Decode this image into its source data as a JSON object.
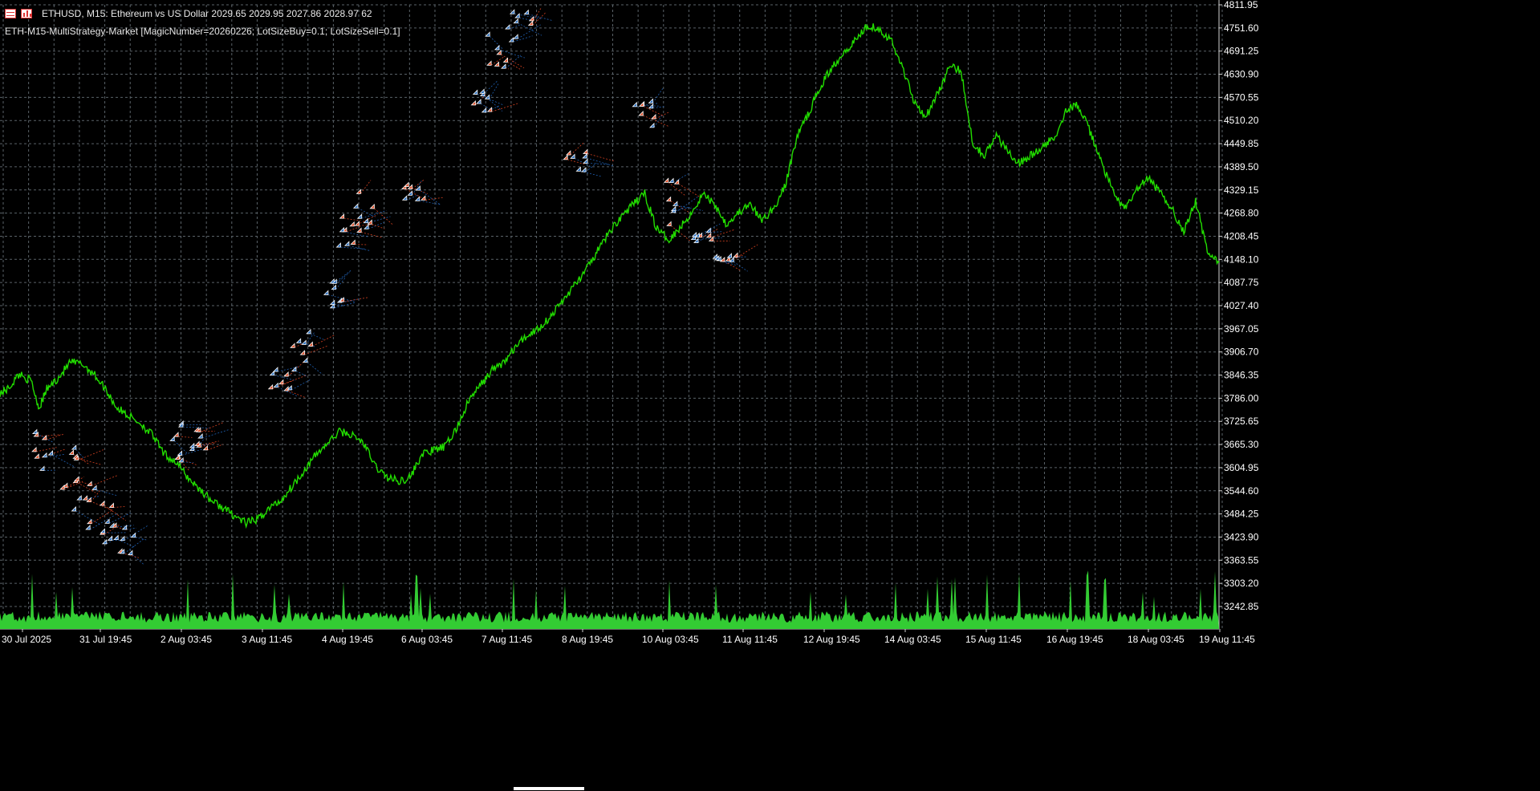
{
  "header": {
    "symbol_line": "ETHUSD, M15:  Ethereum vs US Dollar  2029.65 2029.95 2027.86 2028.97  62",
    "ea_line": "ETH-M15-MultiStrategy-Market [MagicNumber=20260226; LotSizeBuy=0.1; LotSizeSell=0.1]"
  },
  "icons": [
    "table-icon",
    "bar-chart-icon"
  ],
  "colors": {
    "background": "#000000",
    "grid": "#5a6268",
    "price_line": "#22dd00",
    "volume": "#33cc33",
    "buy_marker": "#2a6fc0",
    "sell_marker": "#e0502a",
    "buy_link": "#1f5fb0",
    "sell_link": "#d04020",
    "text": "#ffffff"
  },
  "chart_data": {
    "type": "line",
    "symbol": "ETHUSD",
    "timeframe": "M15",
    "y_ticks": [
      "4811.95",
      "4751.60",
      "4691.25",
      "4630.90",
      "4570.55",
      "4510.20",
      "4449.85",
      "4389.50",
      "4329.15",
      "4268.80",
      "4208.45",
      "4148.10",
      "4087.75",
      "4027.40",
      "3967.05",
      "3906.70",
      "3846.35",
      "3786.00",
      "3725.65",
      "3665.30",
      "3604.95",
      "3544.60",
      "3484.25",
      "3423.90",
      "3363.55",
      "3303.20",
      "3242.85"
    ],
    "ylim": [
      3242.85,
      4811.95
    ],
    "x_ticks": [
      "30 Jul 2025",
      "31 Jul 19:45",
      "2 Aug 03:45",
      "3 Aug 11:45",
      "4 Aug 19:45",
      "6 Aug 03:45",
      "7 Aug 11:45",
      "8 Aug 19:45",
      "10 Aug 03:45",
      "11 Aug 11:45",
      "12 Aug 19:45",
      "14 Aug 03:45",
      "15 Aug 11:45",
      "16 Aug 19:45",
      "18 Aug 03:45",
      "19 Aug 11:45"
    ],
    "grid": true,
    "price_anchors": [
      [
        0,
        3800
      ],
      [
        2,
        3810
      ],
      [
        5,
        3850
      ],
      [
        8,
        3830
      ],
      [
        10,
        3760
      ],
      [
        12,
        3810
      ],
      [
        15,
        3840
      ],
      [
        18,
        3880
      ],
      [
        21,
        3875
      ],
      [
        24,
        3850
      ],
      [
        27,
        3810
      ],
      [
        30,
        3760
      ],
      [
        33,
        3740
      ],
      [
        36,
        3720
      ],
      [
        39,
        3690
      ],
      [
        42,
        3640
      ],
      [
        45,
        3620
      ],
      [
        48,
        3580
      ],
      [
        51,
        3550
      ],
      [
        54,
        3520
      ],
      [
        57,
        3500
      ],
      [
        60,
        3480
      ],
      [
        63,
        3460
      ],
      [
        66,
        3470
      ],
      [
        69,
        3500
      ],
      [
        72,
        3520
      ],
      [
        75,
        3560
      ],
      [
        78,
        3600
      ],
      [
        81,
        3640
      ],
      [
        84,
        3670
      ],
      [
        87,
        3700
      ],
      [
        90,
        3690
      ],
      [
        93,
        3670
      ],
      [
        96,
        3610
      ],
      [
        99,
        3580
      ],
      [
        102,
        3570
      ],
      [
        105,
        3580
      ],
      [
        108,
        3640
      ],
      [
        111,
        3650
      ],
      [
        114,
        3660
      ],
      [
        117,
        3710
      ],
      [
        120,
        3780
      ],
      [
        123,
        3820
      ],
      [
        126,
        3860
      ],
      [
        129,
        3880
      ],
      [
        132,
        3920
      ],
      [
        135,
        3950
      ],
      [
        138,
        3970
      ],
      [
        141,
        4000
      ],
      [
        144,
        4040
      ],
      [
        147,
        4080
      ],
      [
        150,
        4120
      ],
      [
        153,
        4170
      ],
      [
        156,
        4220
      ],
      [
        159,
        4260
      ],
      [
        162,
        4290
      ],
      [
        165,
        4320
      ],
      [
        168,
        4230
      ],
      [
        171,
        4200
      ],
      [
        174,
        4230
      ],
      [
        177,
        4270
      ],
      [
        180,
        4320
      ],
      [
        183,
        4290
      ],
      [
        186,
        4240
      ],
      [
        189,
        4270
      ],
      [
        192,
        4290
      ],
      [
        195,
        4250
      ],
      [
        198,
        4280
      ],
      [
        201,
        4340
      ],
      [
        204,
        4470
      ],
      [
        207,
        4530
      ],
      [
        210,
        4600
      ],
      [
        213,
        4650
      ],
      [
        216,
        4690
      ],
      [
        219,
        4720
      ],
      [
        222,
        4760
      ],
      [
        225,
        4750
      ],
      [
        228,
        4720
      ],
      [
        231,
        4650
      ],
      [
        234,
        4560
      ],
      [
        237,
        4520
      ],
      [
        240,
        4580
      ],
      [
        243,
        4650
      ],
      [
        246,
        4640
      ],
      [
        249,
        4450
      ],
      [
        252,
        4420
      ],
      [
        255,
        4470
      ],
      [
        258,
        4430
      ],
      [
        261,
        4400
      ],
      [
        264,
        4420
      ],
      [
        267,
        4440
      ],
      [
        270,
        4470
      ],
      [
        273,
        4540
      ],
      [
        276,
        4550
      ],
      [
        279,
        4480
      ],
      [
        282,
        4400
      ],
      [
        285,
        4320
      ],
      [
        288,
        4280
      ],
      [
        291,
        4330
      ],
      [
        294,
        4360
      ],
      [
        297,
        4320
      ],
      [
        300,
        4280
      ],
      [
        303,
        4220
      ],
      [
        306,
        4300
      ],
      [
        309,
        4170
      ],
      [
        312,
        4140
      ]
    ],
    "trade_clusters": [
      {
        "t": 12,
        "price_range": [
          3590,
          3720
        ]
      },
      {
        "t": 18,
        "price_range": [
          3540,
          3680
        ]
      },
      {
        "t": 22,
        "price_range": [
          3440,
          3560
        ]
      },
      {
        "t": 28,
        "price_range": [
          3400,
          3520
        ]
      },
      {
        "t": 32,
        "price_range": [
          3370,
          3460
        ]
      },
      {
        "t": 46,
        "price_range": [
          3610,
          3730
        ]
      },
      {
        "t": 51,
        "price_range": [
          3640,
          3700
        ]
      },
      {
        "t": 72,
        "price_range": [
          3800,
          3860
        ]
      },
      {
        "t": 78,
        "price_range": [
          3850,
          3960
        ]
      },
      {
        "t": 86,
        "price_range": [
          4020,
          4090
        ]
      },
      {
        "t": 90,
        "price_range": [
          4160,
          4260
        ]
      },
      {
        "t": 94,
        "price_range": [
          4220,
          4320
        ]
      },
      {
        "t": 106,
        "price_range": [
          4300,
          4340
        ]
      },
      {
        "t": 123,
        "price_range": [
          4460,
          4620
        ]
      },
      {
        "t": 128,
        "price_range": [
          4640,
          4760
        ]
      },
      {
        "t": 134,
        "price_range": [
          4700,
          4800
        ]
      },
      {
        "t": 148,
        "price_range": [
          4370,
          4430
        ]
      },
      {
        "t": 165,
        "price_range": [
          4490,
          4560
        ]
      },
      {
        "t": 172,
        "price_range": [
          4230,
          4360
        ]
      },
      {
        "t": 180,
        "price_range": [
          4190,
          4220
        ]
      },
      {
        "t": 186,
        "price_range": [
          4140,
          4160
        ]
      }
    ]
  }
}
